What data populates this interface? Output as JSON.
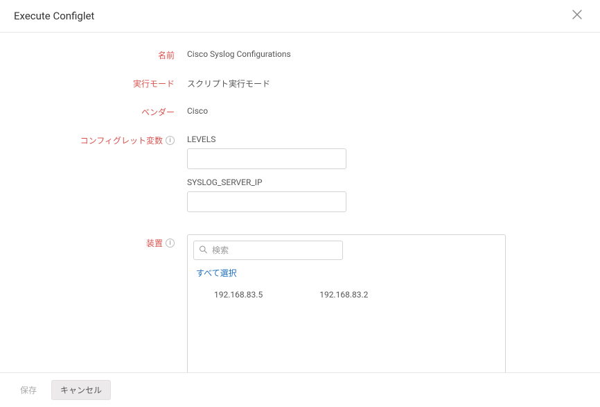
{
  "header": {
    "title": "Execute Configlet"
  },
  "form": {
    "name_label": "名前",
    "name_value": "Cisco Syslog Configurations",
    "mode_label": "実行モード",
    "mode_value": "スクリプト実行モード",
    "vendor_label": "ベンダー",
    "vendor_value": "Cisco",
    "vars_label": "コンフィグレット変数",
    "vars": [
      {
        "name": "LEVELS",
        "value": ""
      },
      {
        "name": "SYSLOG_SERVER_IP",
        "value": ""
      }
    ],
    "devices_label": "装置",
    "search_placeholder": "検索",
    "select_all": "すべて選択",
    "devices": [
      "192.168.83.5",
      "192.168.83.2"
    ]
  },
  "footer": {
    "save": "保存",
    "cancel": "キャンセル"
  }
}
